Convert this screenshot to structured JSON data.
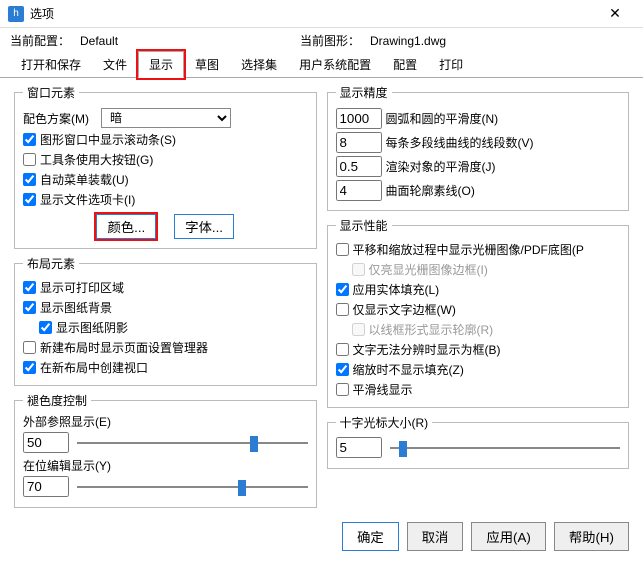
{
  "title": "选项",
  "currentCfgLabel": "当前配置：",
  "currentCfg": "Default",
  "currentDrawLabel": "当前图形：",
  "currentDraw": "Drawing1.dwg",
  "tabs": [
    "打开和保存",
    "文件",
    "显示",
    "草图",
    "选择集",
    "用户系统配置",
    "配置",
    "打印"
  ],
  "winElem": {
    "legend": "窗口元素",
    "schemeLabel": "配色方案(M)",
    "scheme": "暗",
    "scrollbar": "图形窗口中显示滚动条(S)",
    "scrollbar_c": true,
    "bigbtn": "工具条使用大按钮(G)",
    "bigbtn_c": false,
    "automenu": "自动菜单装载(U)",
    "automenu_c": true,
    "filetab": "显示文件选项卡(I)",
    "filetab_c": true,
    "btnColor": "颜色...",
    "btnFont": "字体..."
  },
  "layout": {
    "legend": "布局元素",
    "printable": "显示可打印区域",
    "printable_c": true,
    "paperbg": "显示图纸背景",
    "paperbg_c": true,
    "shadow": "显示图纸阴影",
    "shadow_c": true,
    "pagesetup": "新建布局时显示页面设置管理器",
    "pagesetup_c": false,
    "viewport": "在新布局中创建视口",
    "viewport_c": true
  },
  "fade": {
    "legend": "褪色度控制",
    "xrefLabel": "外部参照显示(E)",
    "xref": "50",
    "editLabel": "在位编辑显示(Y)",
    "edit": "70"
  },
  "precision": {
    "legend": "显示精度",
    "arc": "1000",
    "arcLabel": "圆弧和圆的平滑度(N)",
    "seg": "8",
    "segLabel": "每条多段线曲线的线段数(V)",
    "render": "0.5",
    "renderLabel": "渲染对象的平滑度(J)",
    "contour": "4",
    "contourLabel": "曲面轮廓素线(O)"
  },
  "perf": {
    "legend": "显示性能",
    "raster": "平移和缩放过程中显示光栅图像/PDF底图(P",
    "raster_c": false,
    "hlraster": "仅亮显光栅图像边框(I)",
    "hlraster_c": false,
    "solidfill": "应用实体填充(L)",
    "solidfill_c": true,
    "textframe": "仅显示文字边框(W)",
    "textframe_c": false,
    "wiresil": "以线框形式显示轮廓(R)",
    "wiresil_c": false,
    "textnobox": "文字无法分辨时显示为框(B)",
    "textnobox_c": false,
    "zoomfill": "缩放时不显示填充(Z)",
    "zoomfill_c": true,
    "smooth": "平滑线显示",
    "smooth_c": false
  },
  "cross": {
    "legend": "十字光标大小(R)",
    "val": "5"
  },
  "btns": {
    "ok": "确定",
    "cancel": "取消",
    "apply": "应用(A)",
    "help": "帮助(H)"
  }
}
